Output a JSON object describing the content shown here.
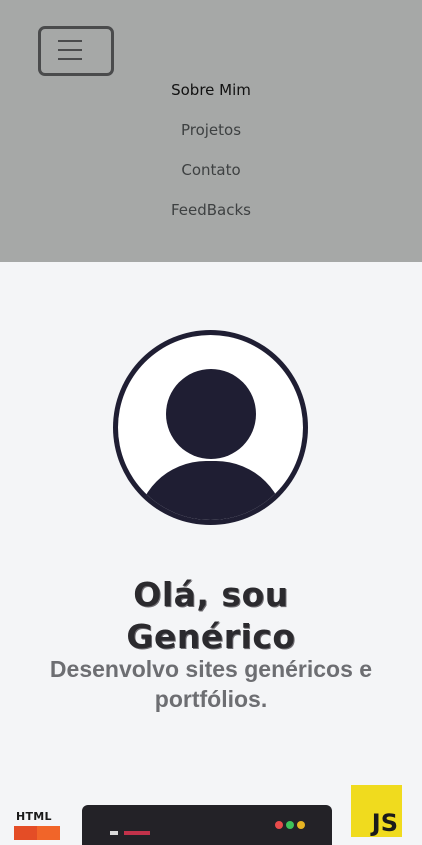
{
  "nav": {
    "items": [
      {
        "label": "Sobre Mim",
        "active": true
      },
      {
        "label": "Projetos",
        "active": false
      },
      {
        "label": "Contato",
        "active": false
      },
      {
        "label": "FeedBacks",
        "active": false
      }
    ]
  },
  "hero": {
    "title_line1": "Olá, sou",
    "title_line2": "Genérico",
    "subtitle": "Desenvolvo sites genéricos e portfólios."
  },
  "tech_logos": {
    "html_text": "HTML",
    "js_text": "JS",
    "colors": {
      "html": "#e44d26",
      "js": "#f0db1e"
    }
  },
  "colors": {
    "navbar_bg": "#a6a8a7",
    "page_bg": "#f4f5f7",
    "avatar": "#1f1e33"
  }
}
